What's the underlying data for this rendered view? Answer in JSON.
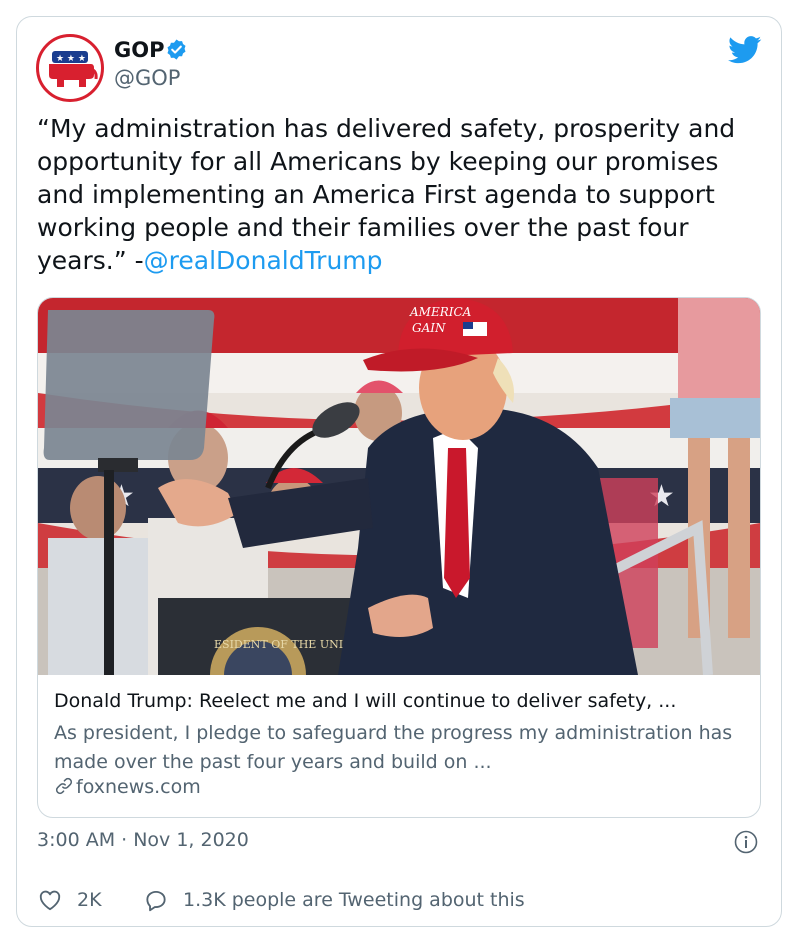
{
  "author": {
    "display_name": "GOP",
    "handle": "@GOP",
    "verified": true
  },
  "tweet": {
    "text": "“My administration has delivered safety, prosperity and opportunity for all Americans by keeping our promises and implementing an America First agenda to support working people and their families over the past four years.” -",
    "mention": "@realDonaldTrump"
  },
  "link_card": {
    "image_hat_text_line1": "AMERICA",
    "image_hat_text_line2": "GAIN",
    "image_seal_text": "ESIDENT OF THE UNI",
    "title": "Donald Trump: Reelect me and I will continue to deliver safety, ...",
    "description": "As president, I pledge to safeguard the progress my administration has made over the past four years and build on ...",
    "domain": "foxnews.com"
  },
  "meta": {
    "timestamp": "3:00 AM · Nov 1, 2020"
  },
  "actions": {
    "likes": "2K",
    "tweeting": "1.3K people are Tweeting about this"
  },
  "colors": {
    "accent": "#1d9bf0",
    "text": "#0f1419",
    "secondary": "#536471",
    "gop_red": "#d8202f"
  },
  "icons": [
    "gop-elephant-logo",
    "verified-badge-icon",
    "twitter-bird-icon",
    "link-chain-icon",
    "info-icon",
    "heart-icon",
    "speech-bubble-icon"
  ]
}
